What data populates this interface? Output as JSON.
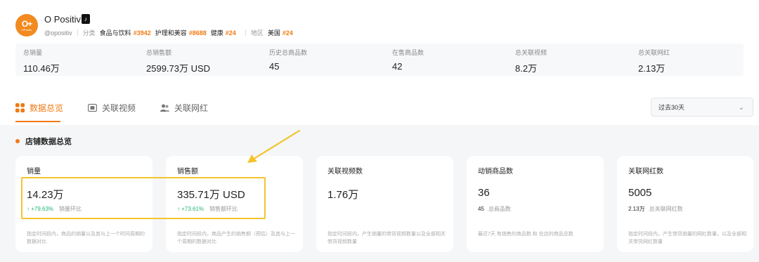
{
  "shop": {
    "name": "O Positiv",
    "handle": "@opositiv",
    "logo_text": "O+",
    "logo_sub": "OPositiv",
    "category_label": "分类",
    "categories": [
      {
        "name": "食品与饮料",
        "rank": "#3942"
      },
      {
        "name": "护理和美容",
        "rank": "#8688"
      },
      {
        "name": "健康",
        "rank": "#24"
      }
    ],
    "region_label": "地区",
    "region": {
      "name": "美国",
      "rank": "#24"
    }
  },
  "stats": [
    {
      "label": "总销量",
      "value": "110.46万"
    },
    {
      "label": "总销售额",
      "value": "2599.73万 USD"
    },
    {
      "label": "历史总商品数",
      "value": "45"
    },
    {
      "label": "在售商品数",
      "value": "42"
    },
    {
      "label": "总关联视频",
      "value": "8.2万"
    },
    {
      "label": "总关联网红",
      "value": "2.13万"
    }
  ],
  "tabs": [
    {
      "label": "数据总览",
      "icon": "grid-icon",
      "active": true
    },
    {
      "label": "关联视频",
      "icon": "video-icon",
      "active": false
    },
    {
      "label": "关联网红",
      "icon": "users-icon",
      "active": false
    }
  ],
  "range": {
    "value": "过去30天",
    "icon": "chevron-down-icon"
  },
  "section": {
    "title": "店铺数据总览"
  },
  "cards": [
    {
      "title": "销量",
      "value": "14.23万",
      "delta": "↑ +79.63%",
      "delta_label": "销量环比",
      "desc": "指定时间段内，商品的销量以及其与上一个时间周期的数据对比"
    },
    {
      "title": "销售额",
      "value": "335.71万 USD",
      "delta": "↑ +73.61%",
      "delta_label": "销售额环比",
      "desc": "指定时间段内，商品产生的销售额（预估）及其与上一个周期的数据对比"
    },
    {
      "title": "关联视频数",
      "value": "1.76万",
      "desc": "指定时间段内，产生销量的带货视频数量以及全部相关带货视频数量"
    },
    {
      "title": "动销商品数",
      "value": "36",
      "sub_value": "45",
      "sub_label": "总商品数",
      "desc": "最近7天 有销售的商品数 和 在店的商品总数"
    },
    {
      "title": "关联网红数",
      "value": "5005",
      "sub_value": "2.13万",
      "sub_label": "总关联网红数",
      "desc": "指定时间段内，产生带货销量的网红数量，以及全部相关带货网红数量"
    }
  ],
  "colors": {
    "accent": "#f07a13",
    "positive": "#22b573",
    "highlight": "#f5c42c"
  }
}
